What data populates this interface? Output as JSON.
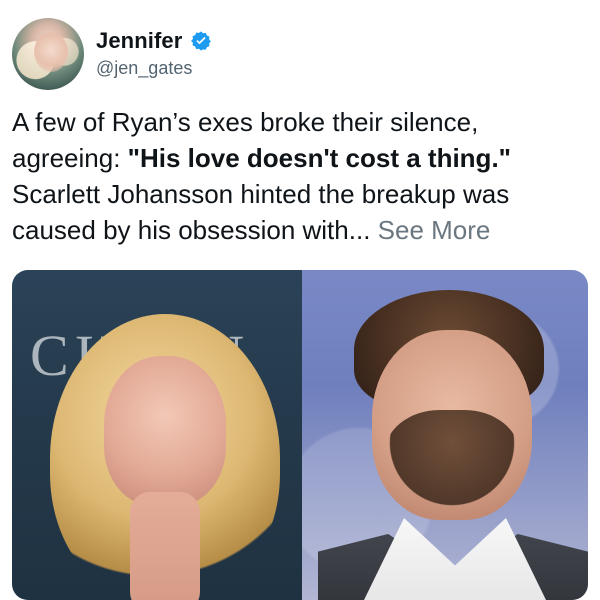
{
  "tweet": {
    "author": {
      "name": "Jennifer",
      "handle": "@jen_gates"
    },
    "text": {
      "part1": "A few of Ryan’s exes broke their silence, agreeing: ",
      "bold": "\"His love doesn't cost a thing.\"",
      "part2": " Scarlett Johansson hinted the breakup was caused by his obsession with...",
      "see_more": "See More"
    }
  },
  "media": {
    "left_backdrop_text": "CIT   EN"
  },
  "icons": {
    "verified": "verified-badge-icon"
  },
  "colors": {
    "verified_blue": "#1d9bf0",
    "text_primary": "#0f1419",
    "text_secondary": "#536471",
    "see_more": "#6b7780"
  }
}
